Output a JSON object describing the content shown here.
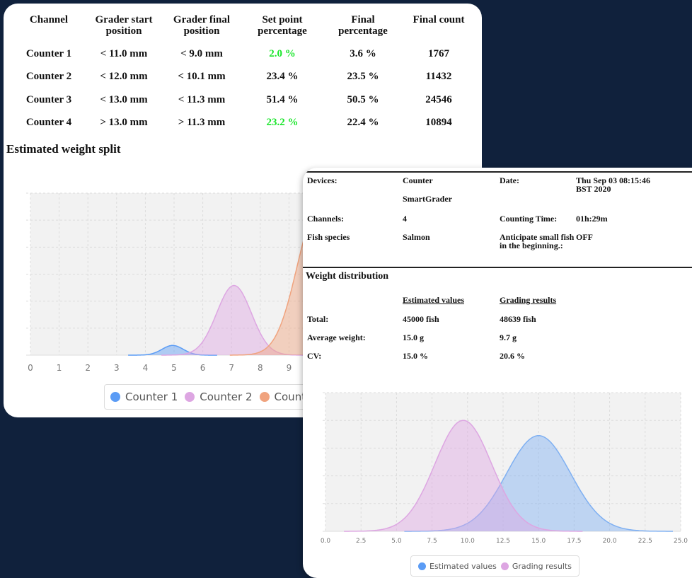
{
  "grading_table": {
    "headers": [
      "Channel",
      "Grader start position",
      "Grader final position",
      "Set point percentage",
      "Final percentage",
      "Final count"
    ],
    "header_lines": [
      [
        "Channel"
      ],
      [
        "Grader start",
        "position"
      ],
      [
        "Grader final",
        "position"
      ],
      [
        "Set point",
        "percentage"
      ],
      [
        "Final",
        "percentage"
      ],
      [
        "Final count"
      ]
    ],
    "rows": [
      {
        "channel": "Counter 1",
        "start": "< 11.0 mm",
        "final": "< 9.0 mm",
        "set_point": "2.0 %",
        "final_pct": "3.6 %",
        "count": "1767",
        "set_point_color": "#19e62a"
      },
      {
        "channel": "Counter 2",
        "start": "< 12.0 mm",
        "final": "< 10.1 mm",
        "set_point": "23.4 %",
        "final_pct": "23.5 %",
        "count": "11432",
        "set_point_color": "#111111"
      },
      {
        "channel": "Counter 3",
        "start": "< 13.0 mm",
        "final": "< 11.3 mm",
        "set_point": "51.4 %",
        "final_pct": "50.5 %",
        "count": "24546",
        "set_point_color": "#111111"
      },
      {
        "channel": "Counter 4",
        "start": ">  13.0 mm",
        "final": ">  11.3 mm",
        "set_point": "23.2 %",
        "final_pct": "22.4 %",
        "count": "10894",
        "set_point_color": "#19e62a"
      }
    ]
  },
  "weight_split": {
    "title": "Estimated weight split",
    "legend": [
      "Counter 1",
      "Counter 2",
      "Counter"
    ]
  },
  "details": {
    "devices_label": "Devices:",
    "devices_value": [
      "Counter",
      "SmartGrader"
    ],
    "date_label": "Date:",
    "date_value": [
      "Thu Sep 03 08:15:46",
      "BST 2020"
    ],
    "channels_label": "Channels:",
    "channels_value": "4",
    "counting_time_label": "Counting Time:",
    "counting_time_value": "01h:29m",
    "species_label": "Fish species",
    "species_value": "Salmon",
    "anticipate_label": [
      "Anticipate small fish",
      "in the beginning.:"
    ],
    "anticipate_value": "OFF"
  },
  "weight_distribution": {
    "title": "Weight distribution",
    "col_estimated": "Estimated values",
    "col_grading": "Grading results",
    "rows": [
      {
        "label": "Total:",
        "estimated": "45000 fish",
        "grading": "48639 fish"
      },
      {
        "label": "Average weight:",
        "estimated": "15.0 g",
        "grading": "9.7 g"
      },
      {
        "label": "CV:",
        "estimated": "15.0 %",
        "grading": "20.6 %"
      }
    ],
    "legend": [
      "Estimated values",
      "Grading results"
    ]
  },
  "chart_data": [
    {
      "type": "area",
      "title": "Estimated weight split",
      "x_ticks": [
        "0",
        "1",
        "2",
        "3",
        "4",
        "5",
        "6",
        "7",
        "8",
        "9",
        "1"
      ],
      "xlim": [
        0,
        10.3
      ],
      "grid": true,
      "legend_position": "bottom",
      "series": [
        {
          "name": "Counter 1",
          "color": "#5b9cf5",
          "mean": 5.1,
          "sd": 0.38,
          "peak": 0.06
        },
        {
          "name": "Counter 2",
          "color": "#dda6e2",
          "mean": 7.3,
          "sd": 0.62,
          "peak": 0.43
        },
        {
          "name": "Counter",
          "color": "#f0a37e",
          "mean": 10.3,
          "sd": 0.75,
          "peak": 0.89
        }
      ]
    },
    {
      "type": "area",
      "x_ticks": [
        "0.0",
        "2.5",
        "5.0",
        "7.5",
        "10.0",
        "12.5",
        "15.0",
        "17.5",
        "20.0",
        "22.5",
        "25.0"
      ],
      "xlim": [
        0,
        25
      ],
      "grid": true,
      "legend_position": "bottom",
      "series": [
        {
          "name": "Estimated values",
          "color": "#7fb0f2",
          "mean": 15.0,
          "sd": 2.25,
          "peak": 0.69
        },
        {
          "name": "Grading results",
          "color": "#dda6e2",
          "mean": 9.7,
          "sd": 2.0,
          "peak": 0.8
        }
      ]
    }
  ]
}
